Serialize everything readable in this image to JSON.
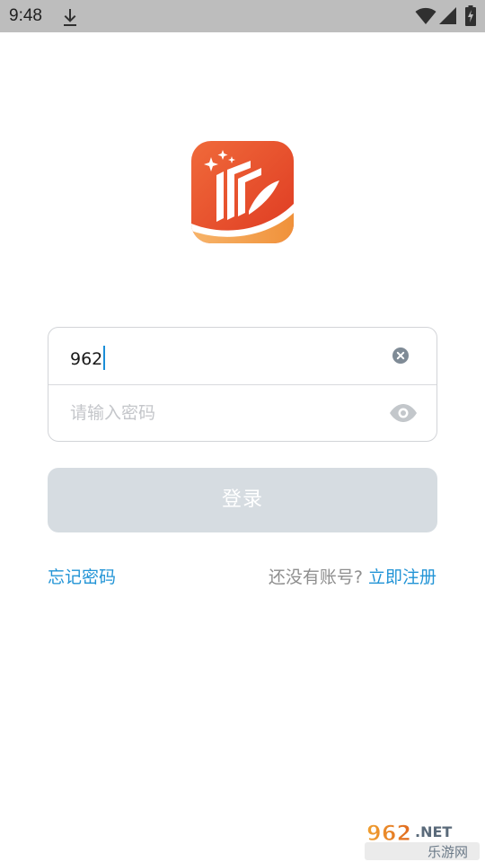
{
  "status_bar": {
    "time": "9:48",
    "icons": [
      "download-icon",
      "wifi-icon",
      "signal-icon",
      "battery-charging-icon"
    ]
  },
  "logo": {
    "icon": "app-logo-icon",
    "colors": {
      "primary": "#e8452b",
      "secondary": "#f08a3a",
      "accent": "#f2a355"
    }
  },
  "login_form": {
    "username_value": "962",
    "password_placeholder": "请输入密码",
    "clear_icon": "clear-icon",
    "visibility_icon": "eye-icon"
  },
  "login_button": {
    "label": "登录",
    "color": "#d6dce1"
  },
  "links": {
    "forgot_password": "忘记密码",
    "no_account": "还没有账号?",
    "register": "立即注册",
    "link_color": "#2294d6"
  },
  "watermark": {
    "brand": "962.NET",
    "subtitle": "乐游网"
  }
}
